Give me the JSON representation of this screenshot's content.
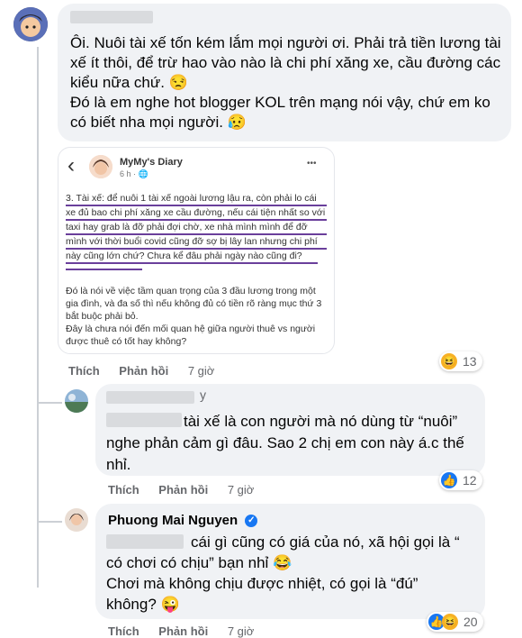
{
  "comment1": {
    "text": "Ôi. Nuôi tài xế tốn kém lắm mọi người ơi. Phải trả tiền lương tài xế ít thôi, để trừ hao vào nào là chi phí xăng xe, cầu đường các kiểu nữa chứ. 😒",
    "text2": "Đó là em nghe hot blogger KOL trên mạng nói vậy, chứ em ko có biết nha mọi người. 😥",
    "like_label": "Thích",
    "reply_label": "Phản hồi",
    "time": "7 giờ",
    "reaction_count": "13"
  },
  "screenshot": {
    "back": "‹",
    "page_name": "MyMy's Diary",
    "page_meta": "6 h · 🌐",
    "menu": "•••",
    "para1": "3. Tài xế: để nuôi 1 tài xế ngoài lương lậu ra, còn phải lo cái xe đủ bao chi phí xăng xe cầu đường, nếu cái tiện nhất so với taxi hay grab là đỡ phải đợi chờ, xe nhà mình mình để đỡ mình với thời buổi covid cũng đỡ sợ bị lây lan nhưng chi phí này cũng lớn chứ? Chưa kể đâu phải ngày nào cũng đi?",
    "para2": "Đó là nói về việc tầm quan trọng của 3 đầu lương trong một gia đình, và đa số thì nếu không đủ có tiền rõ ràng mục thứ 3 bắt buộc phải bỏ.",
    "para3": "Đây là chưa nói đến mối quan hệ giữa người thuê vs người được thuê có tốt hay không?"
  },
  "reply1": {
    "name_suffix": "y",
    "text": "tài xế là con người mà nó dùng từ “nuôi” nghe phản cảm gì đâu. Sao 2 chị em con này á.c thế nhỉ.",
    "like_label": "Thích",
    "reply_label": "Phản hồi",
    "time": "7 giờ",
    "reaction_count": "12"
  },
  "reply2": {
    "author": "Phuong Mai Nguyen",
    "text_a": "cái gì cũng có giá của nó, xã hội gọi là “ có chơi có chịu” bạn nhỉ 😂",
    "text_b": "Chơi mà không chịu được nhiệt, có gọi là “đú” không? 😜",
    "like_label": "Thích",
    "reply_label": "Phản hồi",
    "time": "7 giờ",
    "reaction_count": "20"
  }
}
